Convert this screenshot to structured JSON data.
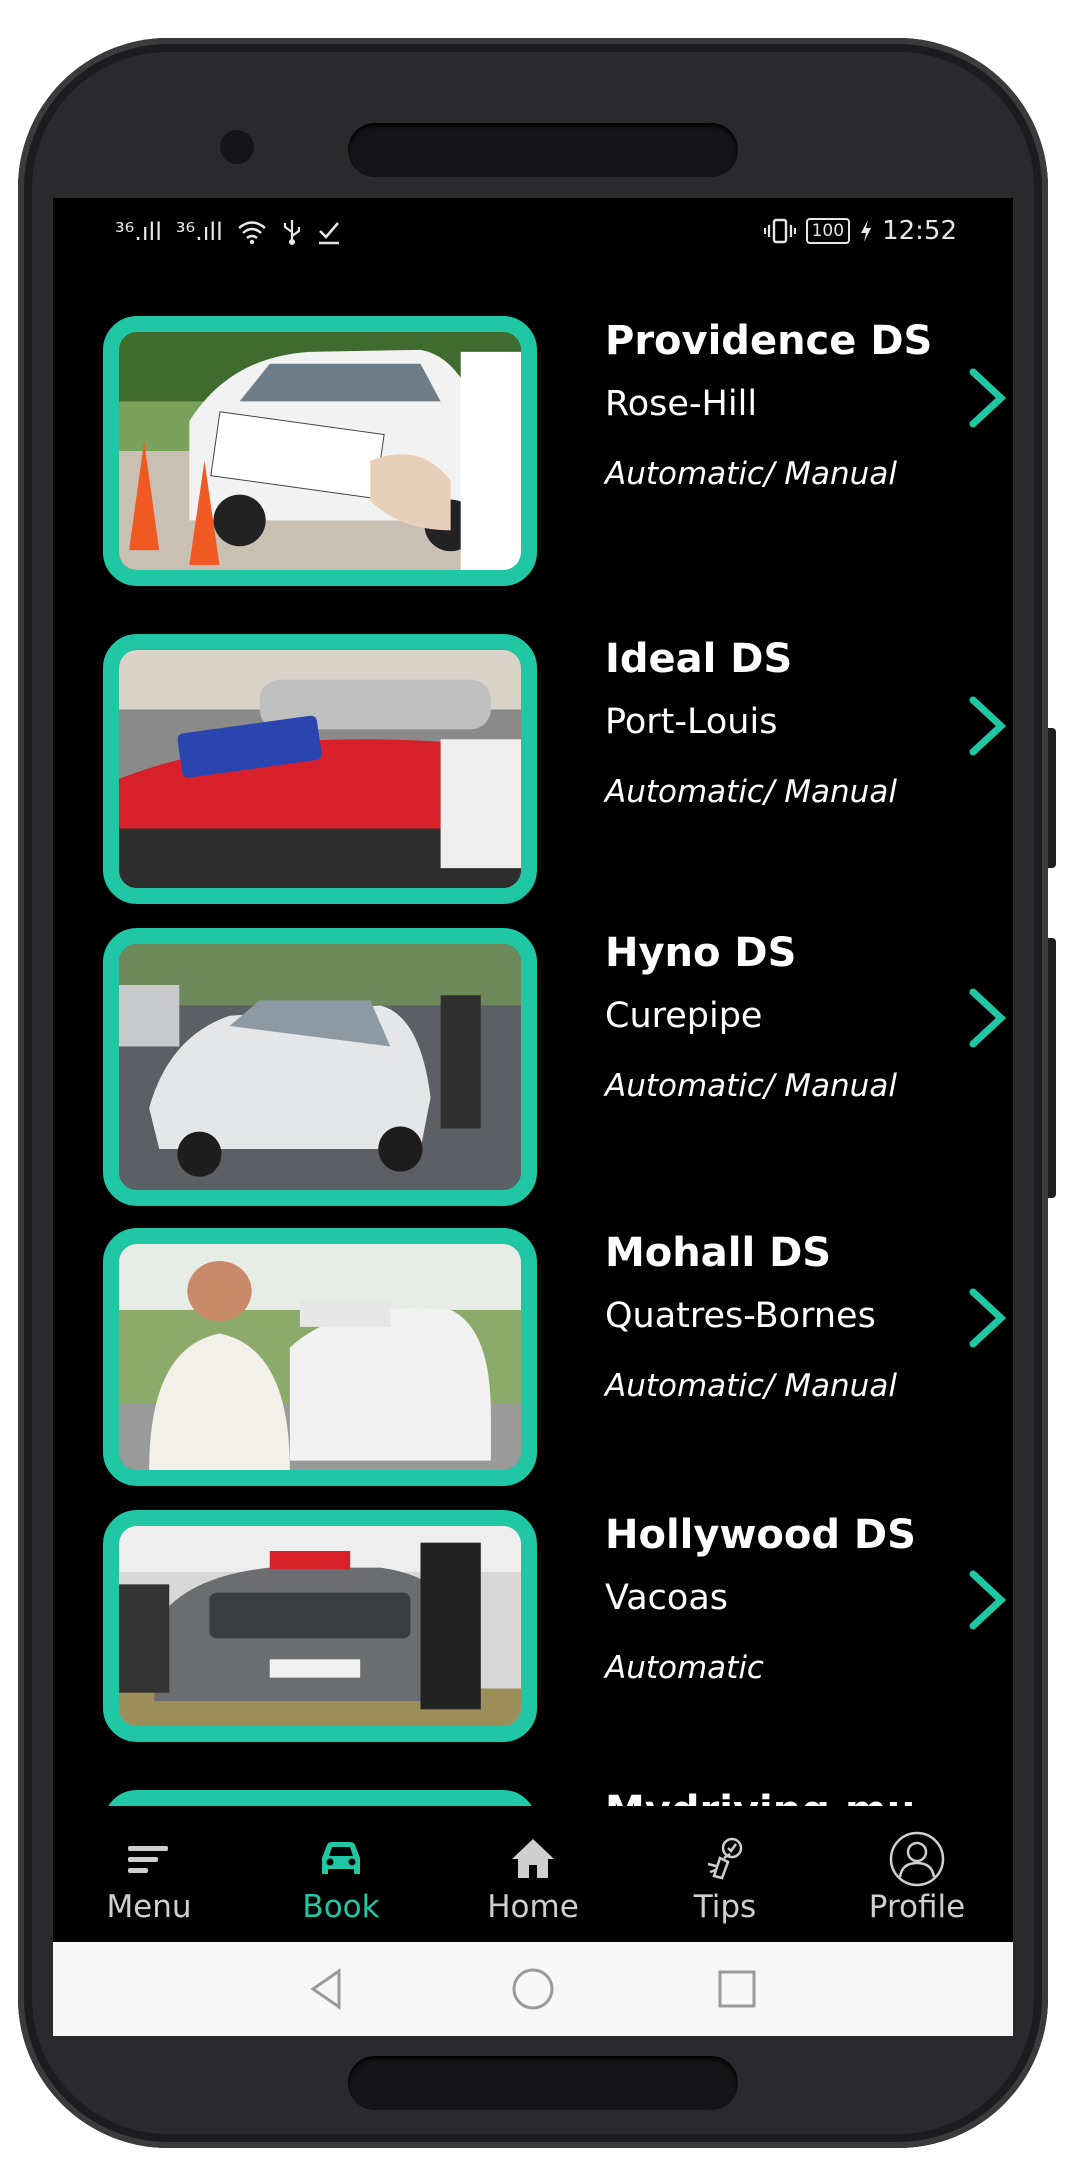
{
  "status_bar": {
    "signal_1": "³⁶.ıll",
    "signal_2": "³⁶.ıll",
    "left_icons": [
      "wifi-icon",
      "usb-icon",
      "download-done-icon"
    ],
    "vibrate_icon": "vibrate-icon",
    "battery": "100",
    "time": "12:52"
  },
  "schools": [
    {
      "name": "Providence DS",
      "location": "Rose-Hill",
      "transmission": "Automatic/ Manual"
    },
    {
      "name": "Ideal DS",
      "location": "Port-Louis",
      "transmission": "Automatic/ Manual"
    },
    {
      "name": "Hyno DS",
      "location": "Curepipe",
      "transmission": "Automatic/ Manual"
    },
    {
      "name": "Mohall DS",
      "location": "Quatres-Bornes",
      "transmission": "Automatic/ Manual"
    },
    {
      "name": "Hollywood DS",
      "location": "Vacoas",
      "transmission": "Automatic"
    },
    {
      "name": "Mydriving.mu",
      "location": "",
      "transmission": ""
    }
  ],
  "bottom_nav": [
    {
      "label": "Menu",
      "icon": "menu-icon"
    },
    {
      "label": "Book",
      "icon": "car-icon",
      "active": true
    },
    {
      "label": "Home",
      "icon": "home-icon"
    },
    {
      "label": "Tips",
      "icon": "tips-icon"
    },
    {
      "label": "Profile",
      "icon": "profile-icon"
    }
  ],
  "colors": {
    "accent": "#20c7a5",
    "background": "#000000",
    "text": "#ffffff"
  }
}
